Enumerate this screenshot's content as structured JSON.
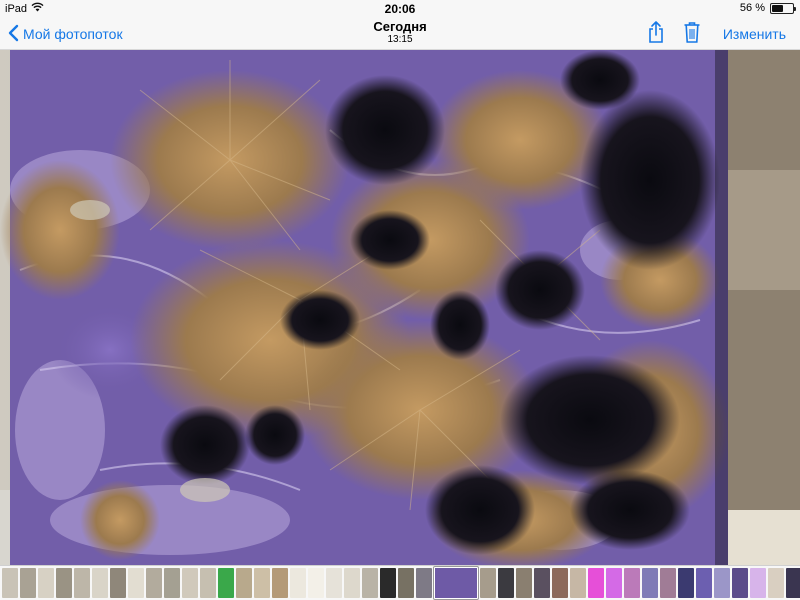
{
  "status_bar": {
    "device": "iPad",
    "time": "20:06",
    "battery_text": "56 %",
    "battery_level": 0.56,
    "icons": [
      "wifi-icon",
      "battery-icon"
    ]
  },
  "nav": {
    "back_label": "Мой фотопоток",
    "title": "Сегодня",
    "subtitle": "13:15",
    "edit_label": "Изменить",
    "icons": [
      "chevron-left-icon",
      "share-icon",
      "trash-icon"
    ],
    "accent_color": "#1678e6"
  },
  "photo": {
    "subject": "charoite mineral slab",
    "colors": {
      "purple": "#6e5aa6",
      "brown": "#9c7a4e",
      "black": "#141218",
      "background": "#b9b3a6"
    }
  },
  "thumbnails": {
    "count": 46,
    "current_index": 24,
    "colors": [
      "#c9c3b6",
      "#a9a294",
      "#d7d1c4",
      "#9a9384",
      "#bdb6a8",
      "#d9d4c8",
      "#8f877a",
      "#e2ddd1",
      "#b2ab9d",
      "#a4a092",
      "#d0c9bb",
      "#c6bfb0",
      "#3aa84a",
      "#b8a98c",
      "#cdbfa6",
      "#b49a78",
      "#ece8de",
      "#f3f0e8",
      "#e6e2d9",
      "#ddd8cc",
      "#b9b3a6",
      "#2a2a2a",
      "#777163",
      "#7e7a86",
      "#6e5aa6",
      "#a69c8c",
      "#3b3a40",
      "#8a7f70",
      "#5a5060",
      "#8c6a5c",
      "#c6b7a5",
      "#e64fd8",
      "#d46ae6",
      "#bb7ab9",
      "#7f7bb6",
      "#a07c96",
      "#3b3a70",
      "#6c5fb0",
      "#9b96c8",
      "#5b4b8a",
      "#d7b4ea",
      "#d9cfc1",
      "#3a3550",
      "#2c2a3a",
      "#5a6ee0",
      "#8f8ab0"
    ]
  }
}
